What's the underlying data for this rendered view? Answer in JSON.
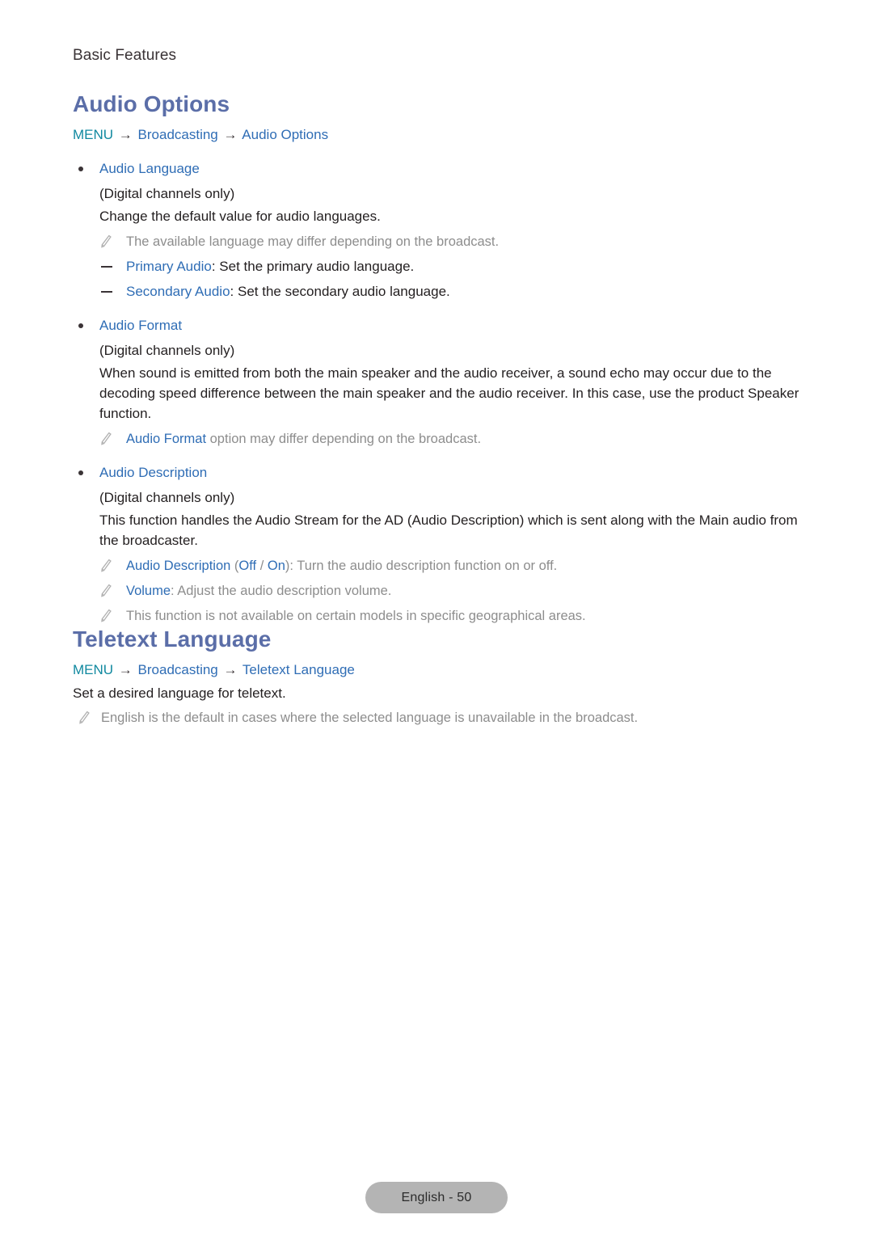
{
  "document": {
    "running_head": "Basic Features",
    "page_label": "English - 50"
  },
  "colors": {
    "heading": "#5b6ea8",
    "link_blue": "#2f6db5",
    "menu_teal": "#1189a0",
    "note_grey": "#8d8d8d",
    "body": "#231f20",
    "pill_bg": "#b4b4b4"
  },
  "sections": [
    {
      "title": "Audio Options",
      "menu_path": {
        "root": "MENU",
        "arrow": "→",
        "nodes": [
          "Broadcasting",
          "Audio Options"
        ]
      },
      "items": [
        {
          "label": "Audio Language",
          "qualifier": "(Digital channels only)",
          "description": "Change the default value for audio languages.",
          "notes": [
            {
              "text": "The available language may differ depending on the broadcast."
            }
          ],
          "dashes": [
            {
              "term": "Primary Audio",
              "rest": ": Set the primary audio language."
            },
            {
              "term": "Secondary Audio",
              "rest": ": Set the secondary audio language."
            }
          ]
        },
        {
          "label": "Audio Format",
          "qualifier": "(Digital channels only)",
          "description": "When sound is emitted from both the main speaker and the audio receiver, a sound echo may occur due to the decoding speed difference between the main speaker and the audio receiver. In this case, use the product Speaker function.",
          "notes": [
            {
              "term": "Audio Format",
              "rest": " option may differ depending on the broadcast."
            }
          ],
          "dashes": []
        },
        {
          "label": "Audio Description",
          "qualifier": "(Digital channels only)",
          "description": "This function handles the Audio Stream for the AD (Audio Description) which is sent along with the Main audio from the broadcaster.",
          "notes": [
            {
              "term": "Audio Description",
              "paren_open": " (",
              "opt1": "Off",
              "paren_sep": " / ",
              "opt2": "On",
              "paren_close": ")",
              "rest": ": Turn the audio description function on or off."
            },
            {
              "term": "Volume",
              "rest": ": Adjust the audio description volume."
            },
            {
              "text": "This function is not available on certain models in specific geographical areas."
            }
          ],
          "dashes": []
        }
      ]
    },
    {
      "title": "Teletext Language",
      "menu_path": {
        "root": "MENU",
        "arrow": "→",
        "nodes": [
          "Broadcasting",
          "Teletext Language"
        ]
      },
      "description": "Set a desired language for teletext.",
      "notes": [
        {
          "text": "English is the default in cases where the selected language is unavailable in the broadcast."
        }
      ]
    }
  ],
  "icons": {
    "pencil": "pencil-icon"
  }
}
